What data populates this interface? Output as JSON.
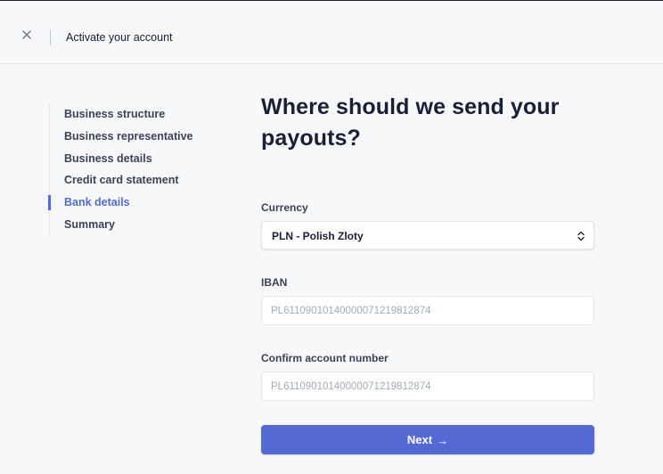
{
  "header": {
    "title": "Activate your account",
    "close_icon": "close-icon"
  },
  "steps": [
    {
      "label": "Business structure",
      "active": false
    },
    {
      "label": "Business representative",
      "active": false
    },
    {
      "label": "Business details",
      "active": false
    },
    {
      "label": "Credit card statement",
      "active": false
    },
    {
      "label": "Bank details",
      "active": true
    },
    {
      "label": "Summary",
      "active": false
    }
  ],
  "form": {
    "heading": "Where should we send your payouts?",
    "currency": {
      "label": "Currency",
      "value": "PLN - Polish Zloty",
      "icon": "chevron-updown-icon"
    },
    "iban": {
      "label": "IBAN",
      "value": "",
      "placeholder": "PL61109010140000071219812874"
    },
    "confirm": {
      "label": "Confirm account number",
      "value": "",
      "placeholder": "PL61109010140000071219812874"
    },
    "next": {
      "label": "Next",
      "arrow": "→"
    }
  },
  "colors": {
    "accent": "#5469d4",
    "text": "#1a1f36",
    "background": "#f7f8fa"
  }
}
